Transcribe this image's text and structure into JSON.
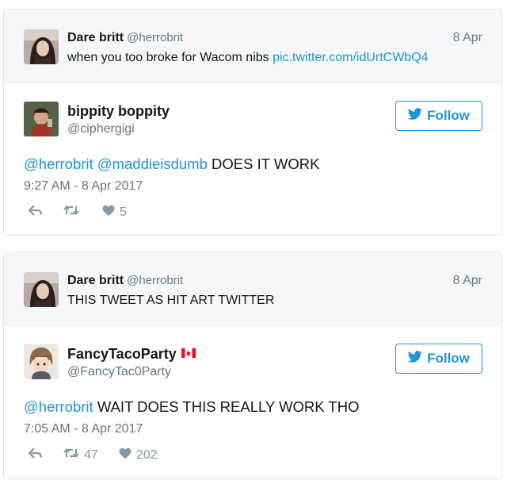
{
  "tweets": [
    {
      "parent": {
        "name": "Dare britt",
        "handle": "@herrobrit",
        "date": "8 Apr",
        "text": "when you too broke for Wacom nibs",
        "link": "pic.twitter.com/idUrtCWbQ4"
      },
      "reply": {
        "name": "bippity boppity",
        "handle": "@ciphergigi",
        "follow_label": "Follow",
        "mentions": "@herrobrit @maddieisdumb",
        "text": "DOES IT WORK",
        "timestamp": "9:27 AM - 8 Apr 2017",
        "retweets": "",
        "likes": "5"
      }
    },
    {
      "parent": {
        "name": "Dare britt",
        "handle": "@herrobrit",
        "date": "8 Apr",
        "text": "THIS TWEET AS HIT ART TWITTER",
        "link": ""
      },
      "reply": {
        "name": "FancyTacoParty",
        "handle": "@FancyTac0Party",
        "follow_label": "Follow",
        "mentions": "@herrobrit",
        "text": "WAIT DOES THIS REALLY WORK THO",
        "timestamp": "7:05 AM - 8 Apr 2017",
        "retweets": "47",
        "likes": "202"
      }
    }
  ],
  "icons": {
    "reply": "reply-arrow-icon",
    "retweet": "retweet-icon",
    "like": "heart-icon",
    "follow": "twitter-bird-icon",
    "flag": "canada-flag-icon"
  },
  "colors": {
    "link": "#1b95e0",
    "muted": "#657786",
    "action": "#8899a6",
    "parent_bg": "#f5f8fa",
    "border": "#e1e8ed"
  }
}
